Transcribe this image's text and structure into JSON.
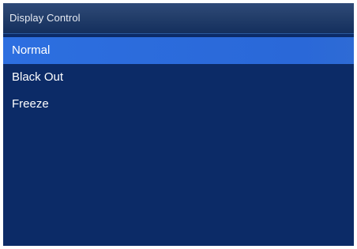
{
  "window": {
    "title": "Display Control"
  },
  "menu": {
    "items": [
      {
        "label": "Normal",
        "selected": true
      },
      {
        "label": "Black Out",
        "selected": false
      },
      {
        "label": "Freeze",
        "selected": false
      }
    ]
  },
  "colors": {
    "background": "#0c2b67",
    "title_bar": "#233e6a",
    "selection": "#2d6fe0",
    "text": "#ffffff"
  }
}
